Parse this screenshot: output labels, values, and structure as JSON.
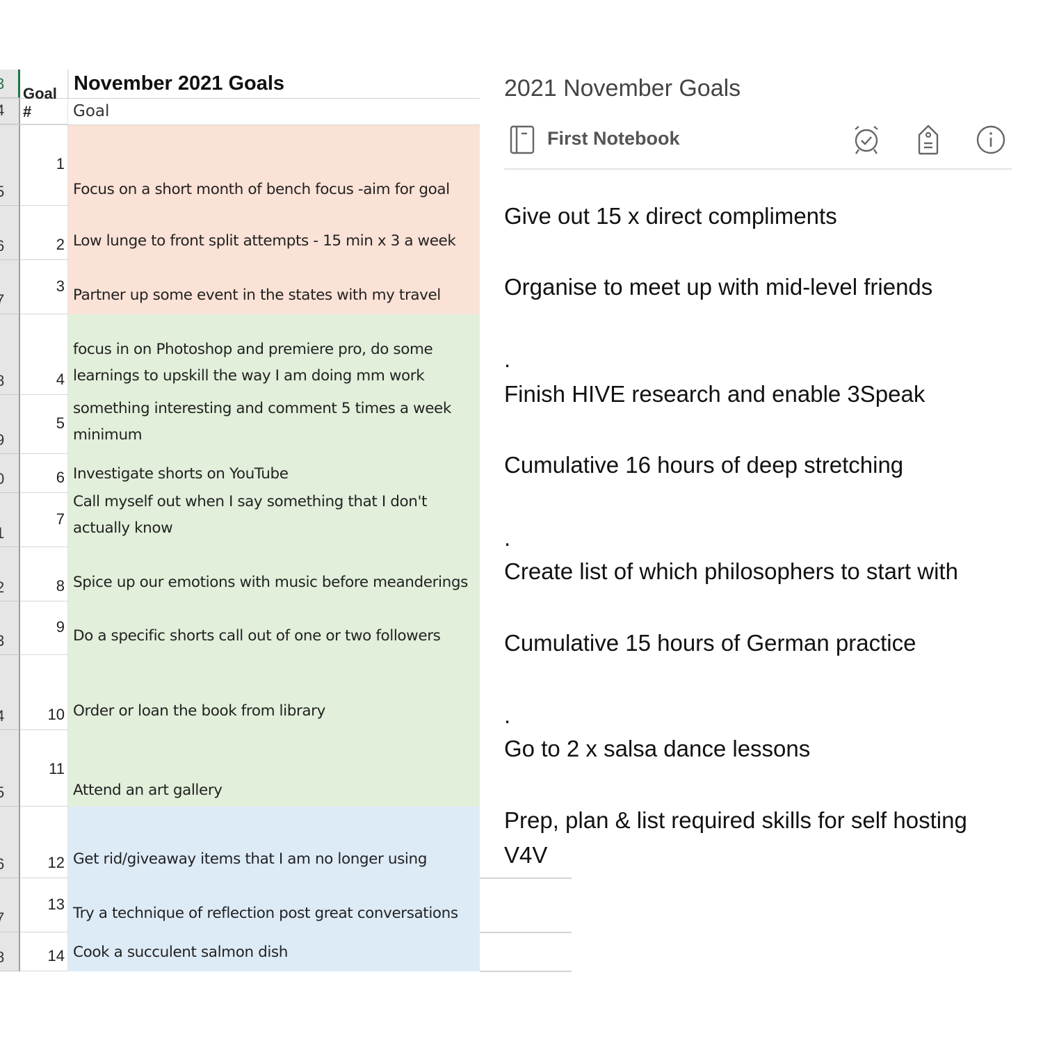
{
  "spreadsheet": {
    "title": "November 2021 Goals",
    "header": {
      "goal_num_label": "Goal #",
      "goal_label": "Goal"
    },
    "row_headers": [
      "3",
      "4",
      "5",
      "6",
      "7",
      "8",
      "9",
      "0",
      "1",
      "2",
      "3",
      "4",
      "5",
      "6",
      "7",
      "8"
    ],
    "colors": {
      "red": "#fbe2d6",
      "green": "#e2efda",
      "blue": "#ddebf7",
      "active_row": "#217346"
    },
    "goals": [
      {
        "num": "1",
        "text": "Focus on a short month of bench focus -aim for goal",
        "color": "red"
      },
      {
        "num": "2",
        "text": "Low lunge to front split attempts - 15 min x 3 a week",
        "color": "red"
      },
      {
        "num": "3",
        "text": "Partner up some event in the states with my travel",
        "color": "red"
      },
      {
        "num": "4",
        "text": "focus in on Photoshop and premiere pro, do some learnings to upskill the way I am doing mm work",
        "color": "green"
      },
      {
        "num": "5",
        "text": "something interesting and comment 5 times a week minimum",
        "color": "green"
      },
      {
        "num": "6",
        "text": "Investigate shorts on YouTube",
        "color": "green"
      },
      {
        "num": "7",
        "text": "Call myself out when I say something that I don't actually know",
        "color": "green"
      },
      {
        "num": "8",
        "text": "Spice up our emotions with music before meanderings",
        "color": "green"
      },
      {
        "num": "9",
        "text": "Do a specific shorts call out of one or two followers",
        "color": "green"
      },
      {
        "num": "10",
        "text": "Order or loan the book from library",
        "color": "green"
      },
      {
        "num": "11",
        "text": "Attend an art gallery",
        "color": "green"
      },
      {
        "num": "12",
        "text": "Get rid/giveaway items that I am no longer using",
        "color": "blue"
      },
      {
        "num": "13",
        "text": "Try a technique of reflection post great conversations",
        "color": "blue"
      },
      {
        "num": "14",
        "text": "Cook a succulent salmon dish",
        "color": "blue"
      }
    ]
  },
  "note": {
    "title": "2021 November Goals",
    "notebook": "First Notebook",
    "icons": [
      "notebook-icon",
      "reminder-alarm-icon",
      "tag-icon",
      "info-icon"
    ],
    "lines": [
      "Give out 15 x direct compliments",
      "Organise to meet up with mid-level friends",
      ".",
      "Finish HIVE research and enable 3Speak",
      "Cumulative 16 hours of deep stretching",
      ".",
      "Create list of which philosophers to start with",
      "Cumulative 15 hours of German practice",
      ".",
      "Go to 2 x salsa dance lessons",
      "Prep, plan & list required skills for self hosting",
      "V4V"
    ]
  }
}
